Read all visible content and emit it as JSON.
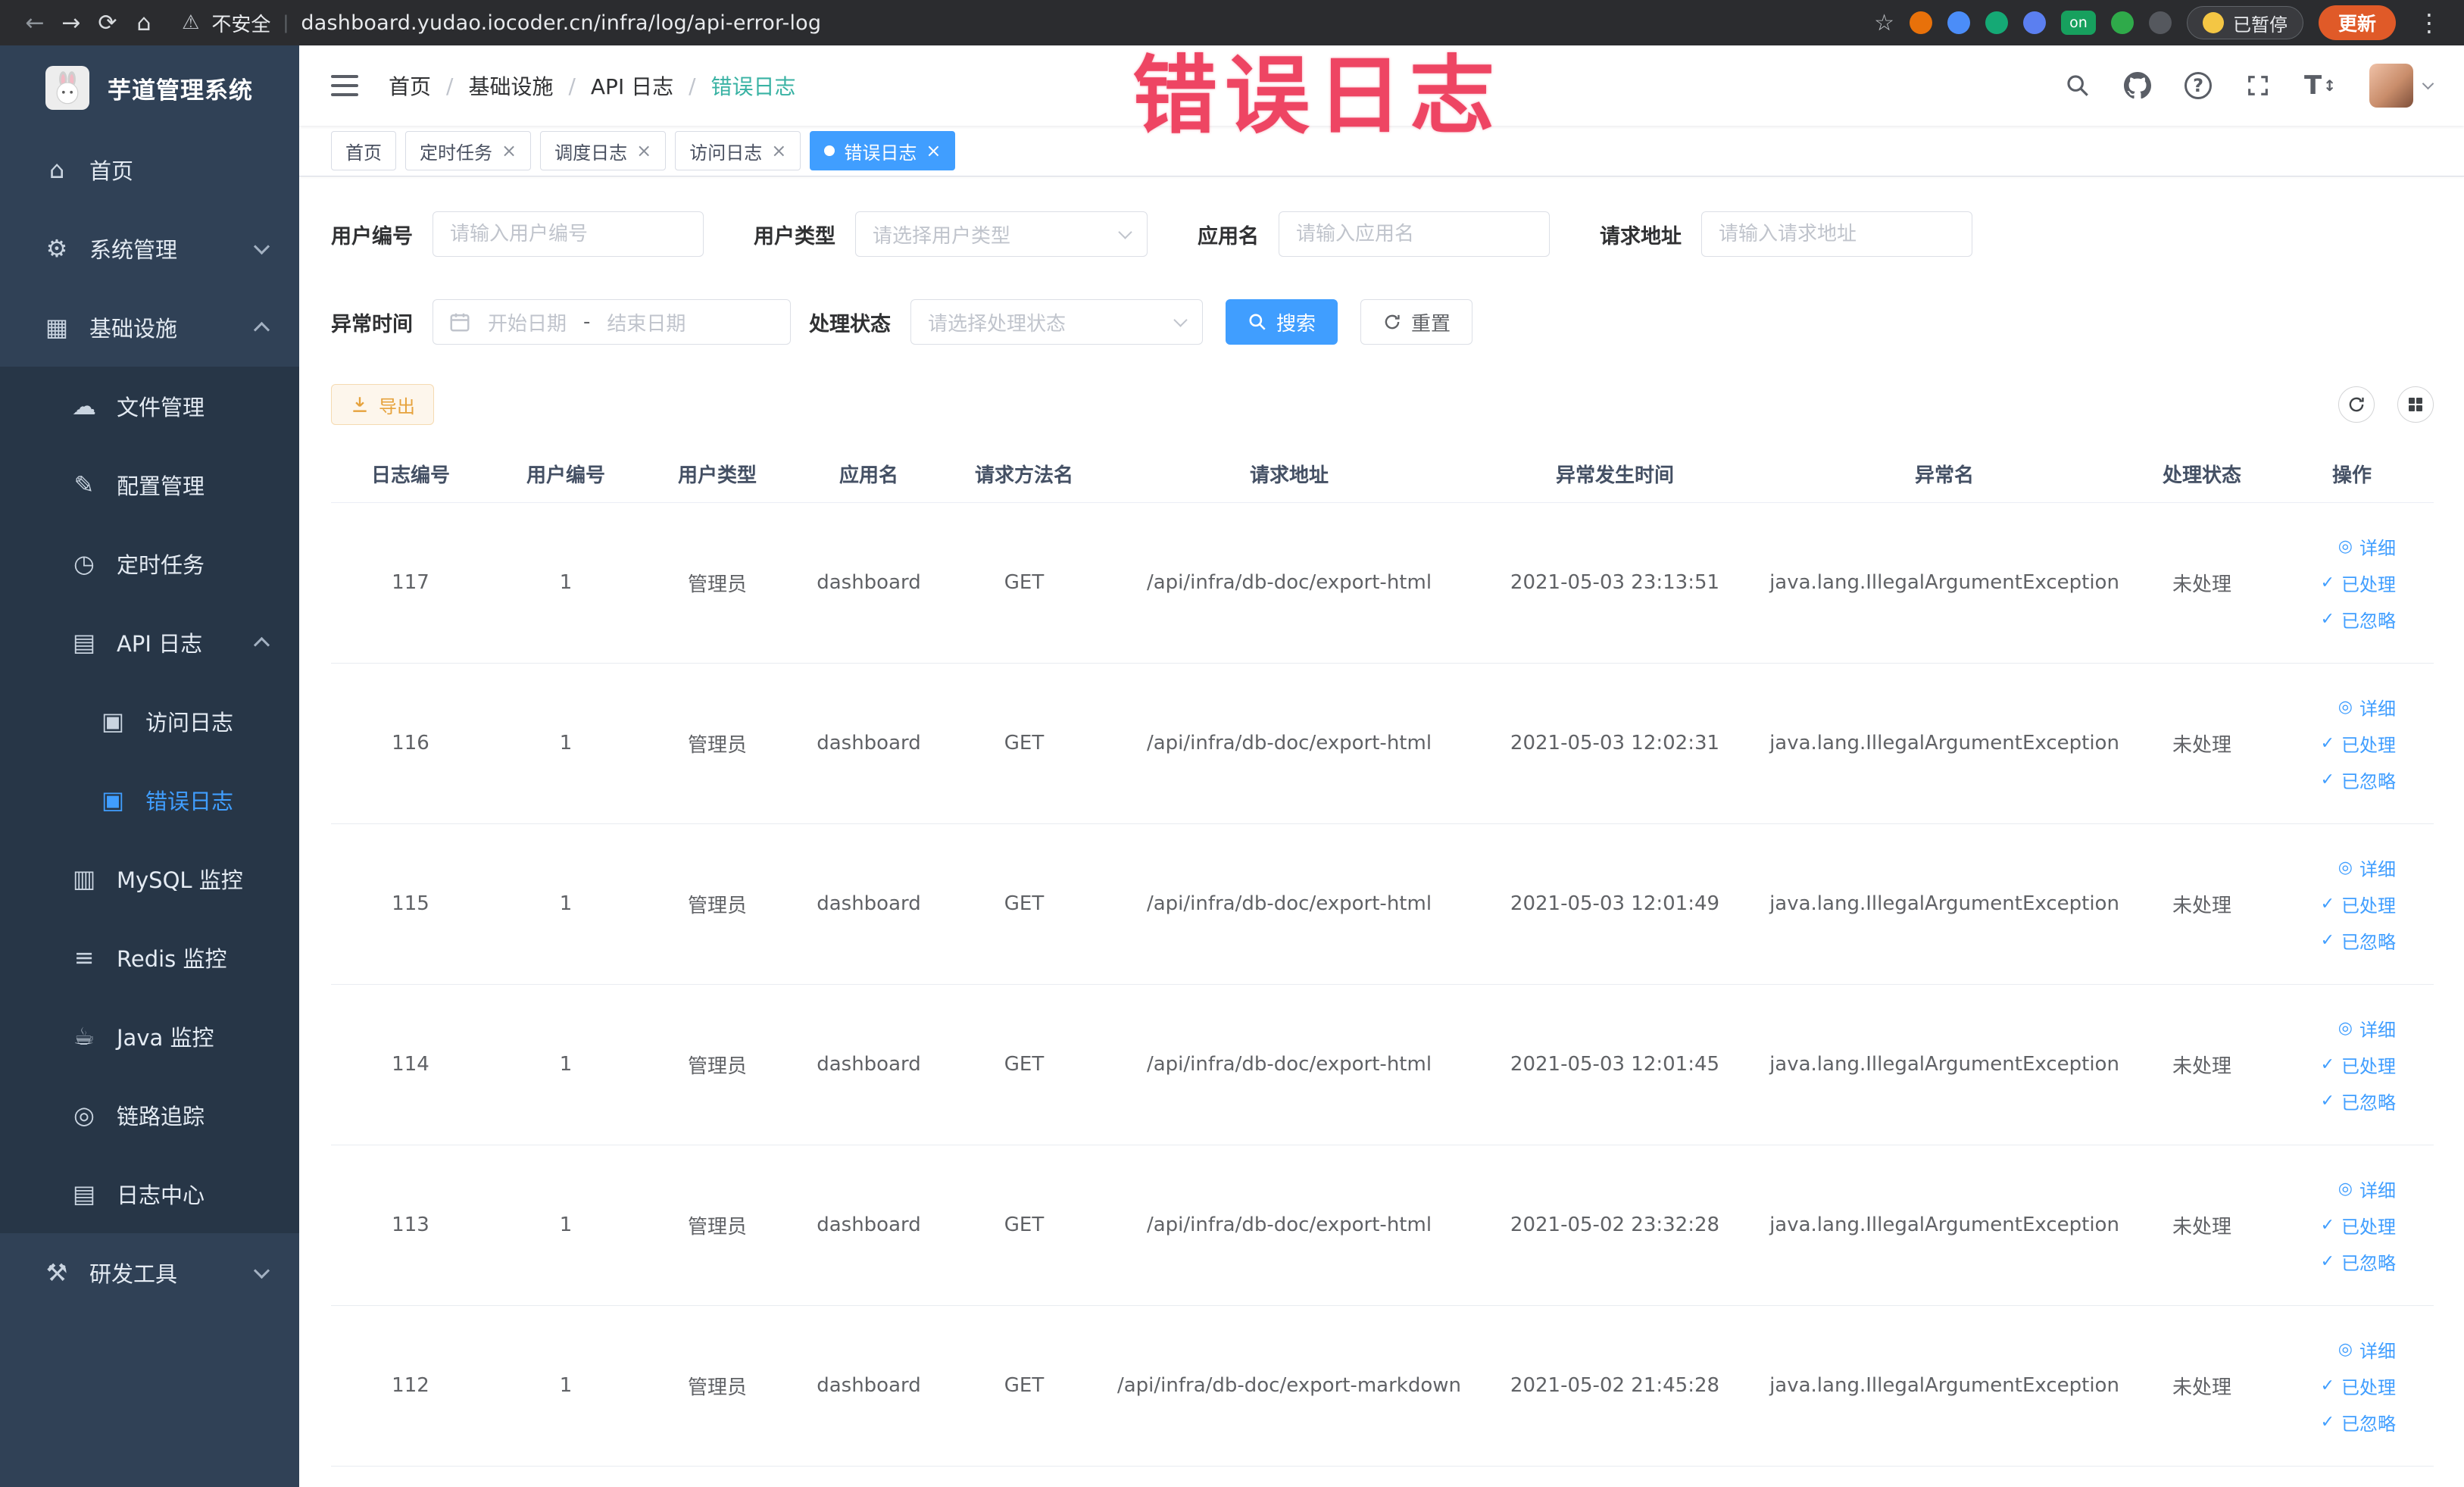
{
  "browser": {
    "security_label": "不安全",
    "url": "dashboard.yudao.iocoder.cn/infra/log/api-error-log",
    "paused_label": "已暂停",
    "update_label": "更新",
    "extension_badge": "on"
  },
  "annotation": {
    "text": "错误日志"
  },
  "sidebar": {
    "logo_title": "芋道管理系统",
    "items": [
      {
        "label": "首页"
      },
      {
        "label": "系统管理"
      },
      {
        "label": "基础设施"
      },
      {
        "label": "文件管理"
      },
      {
        "label": "配置管理"
      },
      {
        "label": "定时任务"
      },
      {
        "label": "API 日志"
      },
      {
        "label": "访问日志"
      },
      {
        "label": "错误日志"
      },
      {
        "label": "MySQL 监控"
      },
      {
        "label": "Redis 监控"
      },
      {
        "label": "Java 监控"
      },
      {
        "label": "链路追踪"
      },
      {
        "label": "日志中心"
      },
      {
        "label": "研发工具"
      }
    ]
  },
  "header": {
    "breadcrumb": [
      "首页",
      "基础设施",
      "API 日志",
      "错误日志"
    ]
  },
  "tabs": {
    "items": [
      {
        "label": "首页"
      },
      {
        "label": "定时任务"
      },
      {
        "label": "调度日志"
      },
      {
        "label": "访问日志"
      },
      {
        "label": "错误日志"
      }
    ]
  },
  "filters": {
    "user_id": {
      "label": "用户编号",
      "placeholder": "请输入用户编号"
    },
    "user_type": {
      "label": "用户类型",
      "placeholder": "请选择用户类型"
    },
    "app_name": {
      "label": "应用名",
      "placeholder": "请输入应用名"
    },
    "request_url": {
      "label": "请求地址",
      "placeholder": "请输入请求地址"
    },
    "exception_time": {
      "label": "异常时间",
      "start_placeholder": "开始日期",
      "separator": "-",
      "end_placeholder": "结束日期"
    },
    "process_status": {
      "label": "处理状态",
      "placeholder": "请选择处理状态"
    },
    "search_label": "搜索",
    "reset_label": "重置"
  },
  "toolbar": {
    "export_label": "导出"
  },
  "table": {
    "headers": [
      "日志编号",
      "用户编号",
      "用户类型",
      "应用名",
      "请求方法名",
      "请求地址",
      "异常发生时间",
      "异常名",
      "处理状态",
      "操作"
    ],
    "action_labels": {
      "detail": "详细",
      "processed": "已处理",
      "ignored": "已忽略"
    },
    "rows": [
      {
        "id": "117",
        "user_id": "1",
        "user_type": "管理员",
        "app_name": "dashboard",
        "method": "GET",
        "url": "/api/infra/db-doc/export-html",
        "time": "2021-05-03 23:13:51",
        "exception": "java.lang.IllegalArgumentException",
        "status": "未处理"
      },
      {
        "id": "116",
        "user_id": "1",
        "user_type": "管理员",
        "app_name": "dashboard",
        "method": "GET",
        "url": "/api/infra/db-doc/export-html",
        "time": "2021-05-03 12:02:31",
        "exception": "java.lang.IllegalArgumentException",
        "status": "未处理"
      },
      {
        "id": "115",
        "user_id": "1",
        "user_type": "管理员",
        "app_name": "dashboard",
        "method": "GET",
        "url": "/api/infra/db-doc/export-html",
        "time": "2021-05-03 12:01:49",
        "exception": "java.lang.IllegalArgumentException",
        "status": "未处理"
      },
      {
        "id": "114",
        "user_id": "1",
        "user_type": "管理员",
        "app_name": "dashboard",
        "method": "GET",
        "url": "/api/infra/db-doc/export-html",
        "time": "2021-05-03 12:01:45",
        "exception": "java.lang.IllegalArgumentException",
        "status": "未处理"
      },
      {
        "id": "113",
        "user_id": "1",
        "user_type": "管理员",
        "app_name": "dashboard",
        "method": "GET",
        "url": "/api/infra/db-doc/export-html",
        "time": "2021-05-02 23:32:28",
        "exception": "java.lang.IllegalArgumentException",
        "status": "未处理"
      },
      {
        "id": "112",
        "user_id": "1",
        "user_type": "管理员",
        "app_name": "dashboard",
        "method": "GET",
        "url": "/api/infra/db-doc/export-markdown",
        "time": "2021-05-02 21:45:28",
        "exception": "java.lang.IllegalArgumentException",
        "status": "未处理"
      }
    ]
  },
  "icons": {
    "home": "⌂",
    "system": "⚙",
    "infra": "▦",
    "file": "☁",
    "config": "✎",
    "job": "◷",
    "api_log": "▤",
    "access_log": "▣",
    "error_log": "▣",
    "mysql": "▥",
    "redis": "≡",
    "java": "☕",
    "trace": "◎",
    "log_center": "▤",
    "devtools": "⚒",
    "back": "←",
    "forward": "→",
    "reload": "⟳",
    "browser_home": "⌂",
    "warning": "⚠",
    "star": "☆",
    "kebab": "⋮",
    "close": "×",
    "view": "◎",
    "check": "✓"
  },
  "colors": {
    "accent": "#409eff",
    "warning": "#e6a23c",
    "annotation": "#ee4563",
    "sidebar_bg": "#304156"
  }
}
